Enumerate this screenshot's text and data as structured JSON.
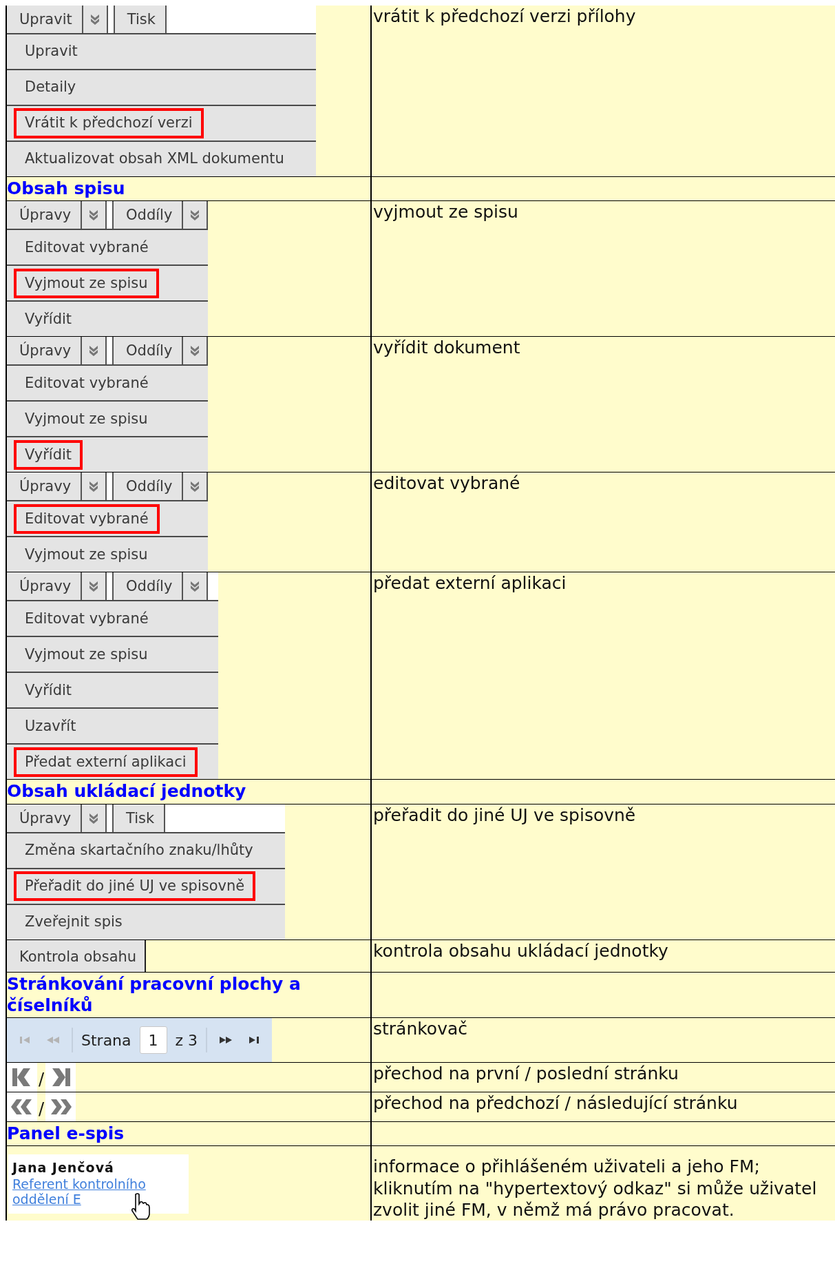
{
  "rows": [
    {
      "kind": "menu",
      "toolbar": [
        {
          "label": "Upravit",
          "dropdown": true
        },
        {
          "label": "Tisk",
          "dropdown": false
        }
      ],
      "items": [
        {
          "label": "Upravit",
          "highlighted": false
        },
        {
          "label": "Detaily",
          "highlighted": false
        },
        {
          "label": "Vrátit k předchozí verzi",
          "highlighted": true
        },
        {
          "label": "Aktualizovat obsah XML dokumentu",
          "highlighted": false
        }
      ],
      "description": "vrátit k předchozí verzi přílohy"
    },
    {
      "kind": "heading",
      "title": "Obsah spisu"
    },
    {
      "kind": "menu",
      "toolbar": [
        {
          "label": "Úpravy",
          "dropdown": true
        },
        {
          "label": "Oddíly",
          "dropdown": true
        }
      ],
      "items": [
        {
          "label": "Editovat vybrané",
          "highlighted": false
        },
        {
          "label": "Vyjmout ze spisu",
          "highlighted": true
        },
        {
          "label": "Vyřídit",
          "highlighted": false
        }
      ],
      "description": "vyjmout ze spisu"
    },
    {
      "kind": "menu",
      "toolbar": [
        {
          "label": "Úpravy",
          "dropdown": true
        },
        {
          "label": "Oddíly",
          "dropdown": true
        }
      ],
      "items": [
        {
          "label": "Editovat vybrané",
          "highlighted": false
        },
        {
          "label": "Vyjmout ze spisu",
          "highlighted": false
        },
        {
          "label": "Vyřídit",
          "highlighted": true
        }
      ],
      "description": "vyřídit dokument"
    },
    {
      "kind": "menu",
      "toolbar": [
        {
          "label": "Úpravy",
          "dropdown": true
        },
        {
          "label": "Oddíly",
          "dropdown": true
        }
      ],
      "items": [
        {
          "label": "Editovat vybrané",
          "highlighted": true
        },
        {
          "label": "Vyjmout ze spisu",
          "highlighted": false
        }
      ],
      "description": "editovat vybrané"
    },
    {
      "kind": "menu",
      "toolbar": [
        {
          "label": "Úpravy",
          "dropdown": true
        },
        {
          "label": "Oddíly",
          "dropdown": true
        }
      ],
      "items": [
        {
          "label": "Editovat vybrané",
          "highlighted": false
        },
        {
          "label": "Vyjmout ze spisu",
          "highlighted": false
        },
        {
          "label": "Vyřídit",
          "highlighted": false
        },
        {
          "label": "Uzavřít",
          "highlighted": false
        },
        {
          "label": "Předat externí aplikaci",
          "highlighted": true
        }
      ],
      "description": "předat externí aplikaci"
    },
    {
      "kind": "heading",
      "title": "Obsah ukládací jednotky"
    },
    {
      "kind": "menu",
      "toolbar": [
        {
          "label": "Úpravy",
          "dropdown": true
        },
        {
          "label": "Tisk",
          "dropdown": false
        }
      ],
      "items": [
        {
          "label": "Změna skartačního znaku/lhůty",
          "highlighted": false
        },
        {
          "label": "Přeřadit do jiné UJ ve spisovně",
          "highlighted": true
        },
        {
          "label": "Zveřejnit spis",
          "highlighted": false
        }
      ],
      "description": "přeřadit do jiné UJ ve spisovně"
    },
    {
      "kind": "button",
      "label": "Kontrola obsahu",
      "description": "kontrola obsahu ukládací jednotky"
    },
    {
      "kind": "heading",
      "title": "Stránkování pracovní plochy a číselníků"
    },
    {
      "kind": "pager",
      "buttons": [
        {
          "kind": "first",
          "disabled": true
        },
        {
          "kind": "prev",
          "disabled": true
        },
        {
          "kind": "next",
          "disabled": false
        },
        {
          "kind": "last",
          "disabled": false
        }
      ],
      "label": "Strana",
      "page": "1",
      "of": "z 3",
      "description": "stránkovač"
    },
    {
      "kind": "icon_pair",
      "icons": [
        {
          "kind": "first"
        },
        {
          "kind": "last"
        }
      ],
      "separator": "/",
      "description": "přechod na první / poslední stránku"
    },
    {
      "kind": "icon_pair",
      "icons": [
        {
          "kind": "prev"
        },
        {
          "kind": "next"
        }
      ],
      "separator": "/",
      "description": "přechod na předchozí / následující stránku"
    },
    {
      "kind": "heading",
      "title": "Panel e-spis"
    },
    {
      "kind": "user",
      "name": "Jana Jenčová",
      "link": "Referent kontrolního oddělení E",
      "description": "informace o přihlášeném uživateli a jeho FM; kliknutím na \"hypertextový odkaz\" si může uživatel zvolit jiné FM, v němž má právo pracovat."
    }
  ]
}
